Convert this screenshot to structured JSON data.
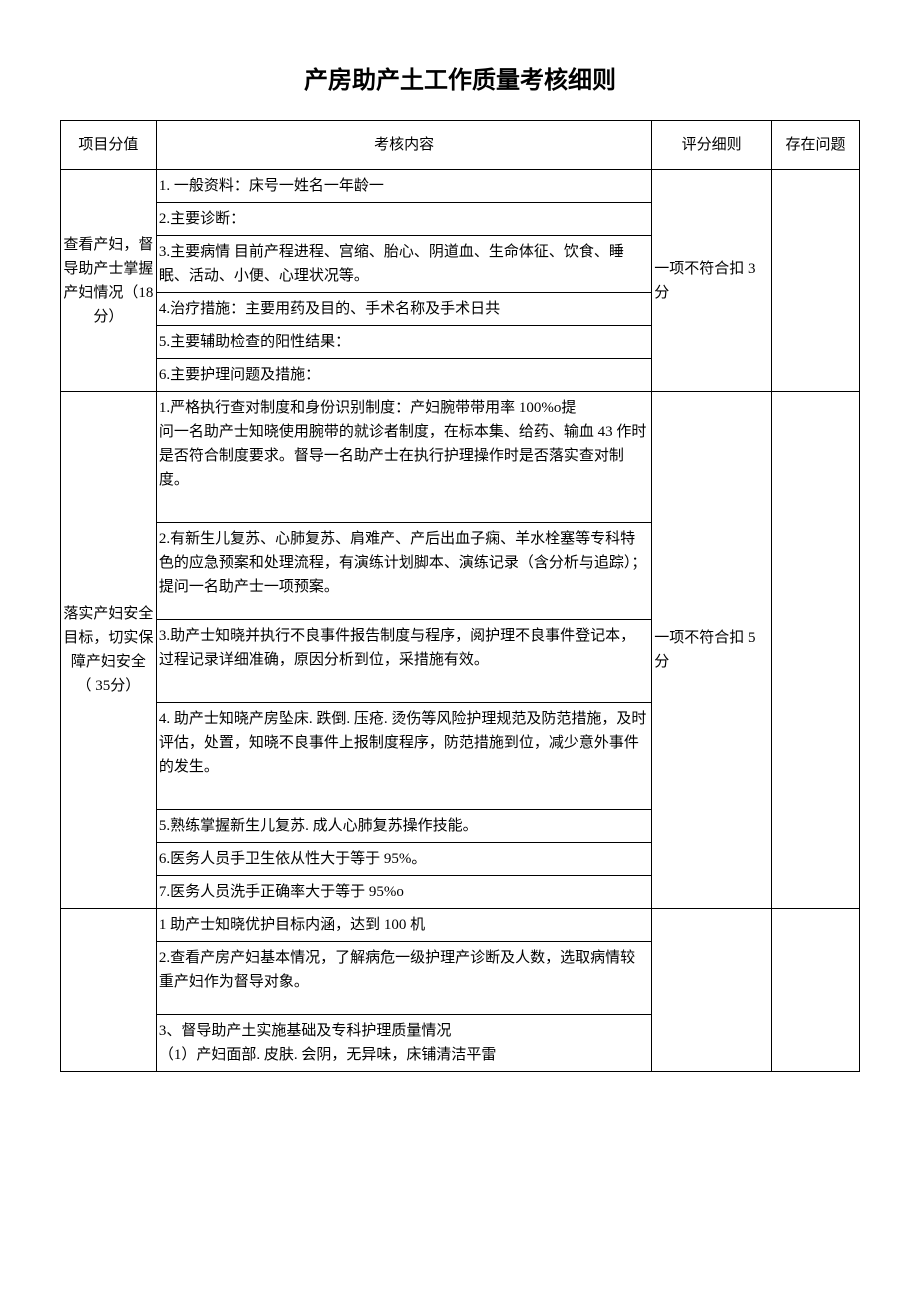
{
  "title": "产房助产土工作质量考核细则",
  "headers": {
    "col1": "项目分值",
    "col2": "考核内容",
    "col3": "评分细则",
    "col4": "存在问题"
  },
  "section1": {
    "project": "查看产妇，督导助产士掌握产妇情况（18 分）",
    "rule": "一项不符合扣 3 分",
    "items": {
      "i1": "1. 一般资料：床号一姓名一年龄一",
      "i2": "2.主要诊断：",
      "i3": "3.主要病情 目前产程进程、宫缩、胎心、阴道血、生命体征、饮食、睡眠、活动、小便、心理状况等。",
      "i4": "4.治疗措施：主要用药及目的、手术名称及手术日共",
      "i5": "5.主要辅助检查的阳性结果：",
      "i6": "6.主要护理问题及措施："
    }
  },
  "section2": {
    "project": "落实产妇安全目标，切实保障产妇安全\n（ 35分）",
    "rule": "一项不符合扣 5 分",
    "items": {
      "i1": "1.严格执行查对制度和身份识别制度：产妇腕带带用率 100%o提\n问一名助产士知晓使用腕带的就诊者制度，在标本集、给药、输血 43 作时是否符合制度要求。督导一名助产士在执行护理操作时是否落实查对制度。",
      "i2": "2.有新生儿复苏、心肺复苏、肩难产、产后出血子痫、羊水栓塞等专科特色的应急预案和处理流程，有演练计划脚本、演练记录（含分析与追踪）；提问一名助产士一项预案。",
      "i3": "3.助产士知晓并执行不良事件报告制度与程序，阅护理不良事件登记本，过程记录详细准确，原因分析到位，采措施有效。",
      "i4": "4. 助产士知晓产房坠床. 跌倒. 压疮. 烫伤等风险护理规范及防范措施，及时评估，处置，知晓不良事件上报制度程序，防范措施到位，减少意外事件的发生。",
      "i5": "5.熟练掌握新生儿复苏. 成人心肺复苏操作技能。",
      "i6": "6.医务人员手卫生依从性大于等于 95%。",
      "i7": "7.医务人员洗手正确率大于等于 95%o"
    }
  },
  "section3": {
    "items": {
      "i1": "1 助产士知晓优护目标内涵，达到 100 机",
      "i2": "2.查看产房产妇基本情况，了解病危一级护理产诊断及人数，选取病情较重产妇作为督导对象。",
      "i3": "3、督导助产土实施基础及专科护理质量情况\n（1）产妇面部. 皮肤. 会阴，无异味，床铺清洁平雷"
    }
  }
}
